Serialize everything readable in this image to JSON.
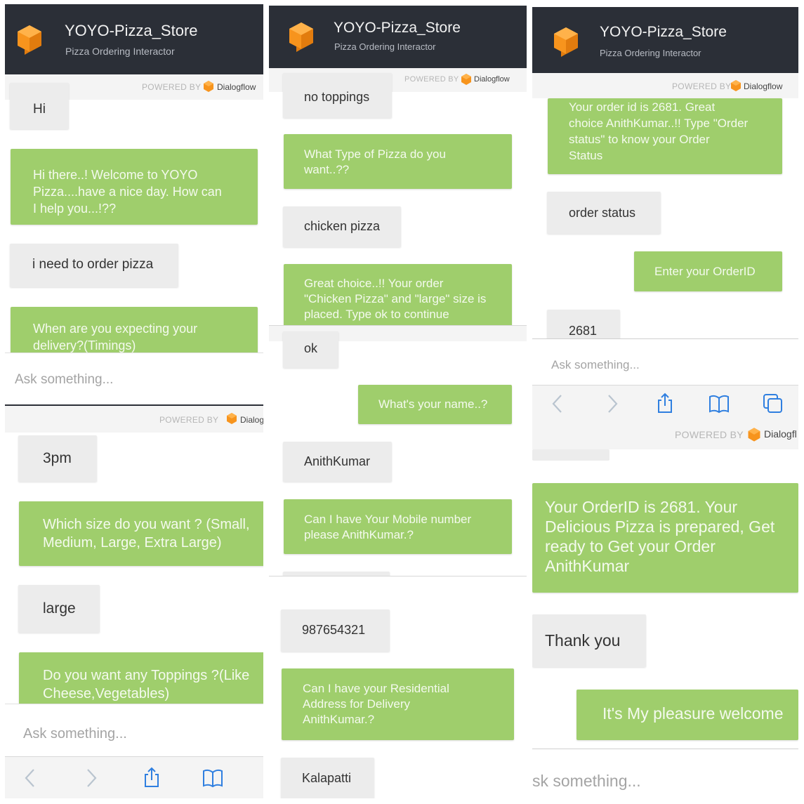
{
  "header": {
    "title": "YOYO-Pizza_Store",
    "subtitle": "Pizza Ordering Interactor",
    "bg_color": "#2b2f37",
    "logo_icon": "dialogflow-cube-icon"
  },
  "powered": {
    "powered_by": "POWERED BY",
    "brand": "Dialogflow",
    "brand_cut": "Dialog",
    "brand_cut2": "Dialogfl"
  },
  "input": {
    "placeholder": "Ask something...",
    "placeholder_cut": "sk something..."
  },
  "colors": {
    "bot_bubble": "#9fce6c",
    "user_bubble": "#ececec",
    "accent_orange": "#f7941d"
  },
  "toolbar_icons": [
    "back-chevron-icon",
    "forward-chevron-icon",
    "share-icon",
    "bookmarks-icon",
    "tabs-icon"
  ],
  "panel1_top": {
    "msgs": [
      "Hi",
      "Hi there..! Welcome to YOYO\nPizza....have a nice day. How can\nI help you...!??",
      "i need to order pizza",
      "When are you expecting your\ndelivery?(Timings)"
    ]
  },
  "panel1_bottom": {
    "msgs": [
      "3pm",
      "Which size do you want ? (Small,\nMedium, Large, Extra Large)",
      "large",
      "Do you want any Toppings ?(Like\nCheese,Vegetables)"
    ]
  },
  "panel2_top": {
    "msgs": [
      "no toppings",
      "What Type of Pizza do you\nwant..??",
      "chicken pizza",
      "Great choice..!! Your order\n\"Chicken Pizza\" and \"large\" size is\nplaced. Type ok to continue"
    ]
  },
  "panel2_mid": {
    "msgs": [
      "ok",
      "What's your name..?",
      "AnithKumar",
      "Can I have Your Mobile number\nplease AnithKumar.?"
    ]
  },
  "panel2_bottom": {
    "msgs": [
      "987654321",
      "Can I have your Residential\nAddress for Delivery\nAnithKumar.?",
      "Kalapatti"
    ]
  },
  "panel3_top": {
    "msgs": [
      "Your order id is 2681. Great\nchoice AnithKumar..!! Type \"Order\nstatus\" to know your Order\nStatus",
      "order status",
      "Enter your OrderID",
      "2681"
    ]
  },
  "panel3_bottom": {
    "msgs": [
      "Your OrderID is 2681. Your\nDelicious Pizza is prepared, Get\nready to Get your Order\nAnithKumar",
      "Thank you",
      "It's My pleasure welcome"
    ]
  }
}
